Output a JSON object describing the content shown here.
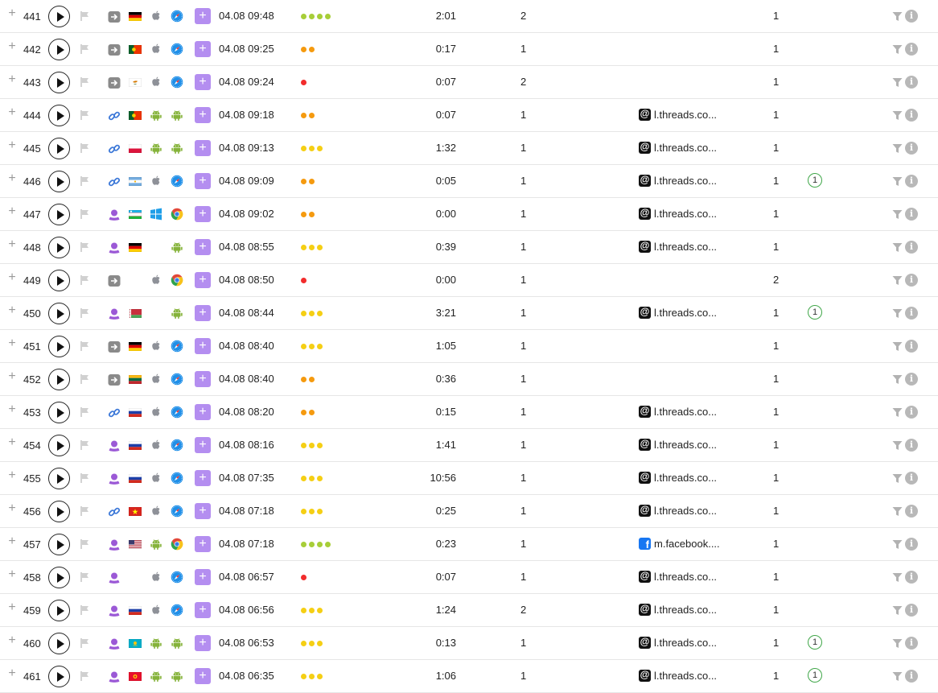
{
  "colors": {
    "accent": "#b48ef0",
    "dot_red": "#f22c2c",
    "dot_orange": "#f59a0f",
    "dot_yellow": "#f5cf14",
    "dot_green": "#a7ce38",
    "badge_green": "#3fa648"
  },
  "icons": {
    "expand": "plus-icon",
    "play": "play-icon",
    "flag": "flag-icon",
    "filter": "filter-icon",
    "info": "info-icon"
  },
  "labels": {
    "add": "+",
    "info": "i"
  },
  "rows": [
    {
      "num": "441",
      "source": "direct",
      "country": "de",
      "os": "apple",
      "browser": "safari",
      "date": "04.08 09:48",
      "dots": [
        "green",
        "green",
        "green",
        "green"
      ],
      "duration": "2:01",
      "pages": "2",
      "referrer": null,
      "visits": "1",
      "badge": null
    },
    {
      "num": "442",
      "source": "direct",
      "country": "pt",
      "os": "apple",
      "browser": "safari",
      "date": "04.08 09:25",
      "dots": [
        "orange",
        "orange"
      ],
      "duration": "0:17",
      "pages": "1",
      "referrer": null,
      "visits": "1",
      "badge": null
    },
    {
      "num": "443",
      "source": "direct",
      "country": "cy",
      "os": "apple",
      "browser": "safari",
      "date": "04.08 09:24",
      "dots": [
        "red"
      ],
      "duration": "0:07",
      "pages": "2",
      "referrer": null,
      "visits": "1",
      "badge": null
    },
    {
      "num": "444",
      "source": "link",
      "country": "pt",
      "os": "android",
      "browser": "android",
      "date": "04.08 09:18",
      "dots": [
        "orange",
        "orange"
      ],
      "duration": "0:07",
      "pages": "1",
      "referrer": {
        "type": "threads",
        "text": "l.threads.co..."
      },
      "visits": "1",
      "badge": null
    },
    {
      "num": "445",
      "source": "link",
      "country": "pl",
      "os": "android",
      "browser": "android",
      "date": "04.08 09:13",
      "dots": [
        "yellow",
        "yellow",
        "yellow"
      ],
      "duration": "1:32",
      "pages": "1",
      "referrer": {
        "type": "threads",
        "text": "l.threads.co..."
      },
      "visits": "1",
      "badge": null
    },
    {
      "num": "446",
      "source": "link",
      "country": "ar",
      "os": "apple",
      "browser": "safari",
      "date": "04.08 09:09",
      "dots": [
        "orange",
        "orange"
      ],
      "duration": "0:05",
      "pages": "1",
      "referrer": {
        "type": "threads",
        "text": "l.threads.co..."
      },
      "visits": "1",
      "badge": "1"
    },
    {
      "num": "447",
      "source": "social",
      "country": "uz",
      "os": "windows",
      "browser": "chrome",
      "date": "04.08 09:02",
      "dots": [
        "orange",
        "orange"
      ],
      "duration": "0:00",
      "pages": "1",
      "referrer": {
        "type": "threads",
        "text": "l.threads.co..."
      },
      "visits": "1",
      "badge": null
    },
    {
      "num": "448",
      "source": "social",
      "country": "de",
      "os": null,
      "browser": "android",
      "date": "04.08 08:55",
      "dots": [
        "yellow",
        "yellow",
        "yellow"
      ],
      "duration": "0:39",
      "pages": "1",
      "referrer": {
        "type": "threads",
        "text": "l.threads.co..."
      },
      "visits": "1",
      "badge": null
    },
    {
      "num": "449",
      "source": "direct",
      "country": null,
      "os": "apple",
      "browser": "chrome",
      "date": "04.08 08:50",
      "dots": [
        "red"
      ],
      "duration": "0:00",
      "pages": "1",
      "referrer": null,
      "visits": "2",
      "badge": null
    },
    {
      "num": "450",
      "source": "social",
      "country": "by",
      "os": null,
      "browser": "android",
      "date": "04.08 08:44",
      "dots": [
        "yellow",
        "yellow",
        "yellow"
      ],
      "duration": "3:21",
      "pages": "1",
      "referrer": {
        "type": "threads",
        "text": "l.threads.co..."
      },
      "visits": "1",
      "badge": "1"
    },
    {
      "num": "451",
      "source": "direct",
      "country": "de",
      "os": "apple",
      "browser": "safari",
      "date": "04.08 08:40",
      "dots": [
        "yellow",
        "yellow",
        "yellow"
      ],
      "duration": "1:05",
      "pages": "1",
      "referrer": null,
      "visits": "1",
      "badge": null
    },
    {
      "num": "452",
      "source": "direct",
      "country": "lt",
      "os": "apple",
      "browser": "safari",
      "date": "04.08 08:40",
      "dots": [
        "orange",
        "orange"
      ],
      "duration": "0:36",
      "pages": "1",
      "referrer": null,
      "visits": "1",
      "badge": null
    },
    {
      "num": "453",
      "source": "link",
      "country": "ru",
      "os": "apple",
      "browser": "safari",
      "date": "04.08 08:20",
      "dots": [
        "orange",
        "orange"
      ],
      "duration": "0:15",
      "pages": "1",
      "referrer": {
        "type": "threads",
        "text": "l.threads.co..."
      },
      "visits": "1",
      "badge": null
    },
    {
      "num": "454",
      "source": "social",
      "country": "ru",
      "os": "apple",
      "browser": "safari",
      "date": "04.08 08:16",
      "dots": [
        "yellow",
        "yellow",
        "yellow"
      ],
      "duration": "1:41",
      "pages": "1",
      "referrer": {
        "type": "threads",
        "text": "l.threads.co..."
      },
      "visits": "1",
      "badge": null
    },
    {
      "num": "455",
      "source": "social",
      "country": "ru",
      "os": "apple",
      "browser": "safari",
      "date": "04.08 07:35",
      "dots": [
        "yellow",
        "yellow",
        "yellow"
      ],
      "duration": "10:56",
      "pages": "1",
      "referrer": {
        "type": "threads",
        "text": "l.threads.co..."
      },
      "visits": "1",
      "badge": null
    },
    {
      "num": "456",
      "source": "link",
      "country": "vn",
      "os": "apple",
      "browser": "safari",
      "date": "04.08 07:18",
      "dots": [
        "yellow",
        "yellow",
        "yellow"
      ],
      "duration": "0:25",
      "pages": "1",
      "referrer": {
        "type": "threads",
        "text": "l.threads.co..."
      },
      "visits": "1",
      "badge": null
    },
    {
      "num": "457",
      "source": "social",
      "country": "us",
      "os": "android",
      "browser": "chrome",
      "date": "04.08 07:18",
      "dots": [
        "green",
        "green",
        "green",
        "green"
      ],
      "duration": "0:23",
      "pages": "1",
      "referrer": {
        "type": "facebook",
        "text": "m.facebook...."
      },
      "visits": "1",
      "badge": null
    },
    {
      "num": "458",
      "source": "social",
      "country": null,
      "os": "apple",
      "browser": "safari",
      "date": "04.08 06:57",
      "dots": [
        "red"
      ],
      "duration": "0:07",
      "pages": "1",
      "referrer": {
        "type": "threads",
        "text": "l.threads.co..."
      },
      "visits": "1",
      "badge": null
    },
    {
      "num": "459",
      "source": "social",
      "country": "ru",
      "os": "apple",
      "browser": "safari",
      "date": "04.08 06:56",
      "dots": [
        "yellow",
        "yellow",
        "yellow"
      ],
      "duration": "1:24",
      "pages": "2",
      "referrer": {
        "type": "threads",
        "text": "l.threads.co..."
      },
      "visits": "1",
      "badge": null
    },
    {
      "num": "460",
      "source": "social",
      "country": "kz",
      "os": "android",
      "browser": "android",
      "date": "04.08 06:53",
      "dots": [
        "yellow",
        "yellow",
        "yellow"
      ],
      "duration": "0:13",
      "pages": "1",
      "referrer": {
        "type": "threads",
        "text": "l.threads.co..."
      },
      "visits": "1",
      "badge": "1"
    },
    {
      "num": "461",
      "source": "social",
      "country": "kg",
      "os": "android",
      "browser": "android",
      "date": "04.08 06:35",
      "dots": [
        "yellow",
        "yellow",
        "yellow"
      ],
      "duration": "1:06",
      "pages": "1",
      "referrer": {
        "type": "threads",
        "text": "l.threads.co..."
      },
      "visits": "1",
      "badge": "1"
    }
  ]
}
